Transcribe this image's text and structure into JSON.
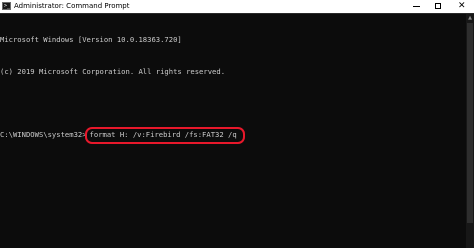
{
  "window": {
    "title": "Administrator: Command Prompt",
    "icon": "terminal-icon",
    "icon_glyph": ">_",
    "controls": {
      "minimize": "minimize-icon",
      "maximize": "maximize-icon",
      "close": "close-icon",
      "close_glyph": "✕"
    }
  },
  "console": {
    "lines": [
      "Microsoft Windows [Version 10.0.18363.720]",
      "(c) 2019 Microsoft Corporation. All rights reserved.",
      ""
    ],
    "prompt": "C:\\WINDOWS\\system32>",
    "command": "format H: /v:Firebird /fs:FAT32 /q"
  },
  "colors": {
    "background": "#0c0c0c",
    "text": "#cccccc",
    "highlight": "#e8182b",
    "titlebar": "#ffffff"
  }
}
